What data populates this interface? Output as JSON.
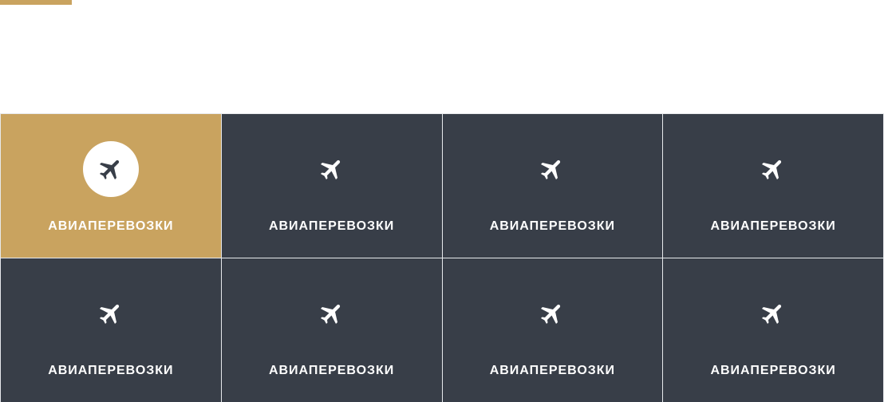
{
  "accent_color": "#c9a35f",
  "tile_color": "#383e48",
  "tiles": [
    {
      "label": "АВИАПЕРЕВОЗКИ",
      "icon": "airplane-icon",
      "active": true
    },
    {
      "label": "АВИАПЕРЕВОЗКИ",
      "icon": "airplane-icon",
      "active": false
    },
    {
      "label": "АВИАПЕРЕВОЗКИ",
      "icon": "airplane-icon",
      "active": false
    },
    {
      "label": "АВИАПЕРЕВОЗКИ",
      "icon": "airplane-icon",
      "active": false
    },
    {
      "label": "АВИАПЕРЕВОЗКИ",
      "icon": "airplane-icon",
      "active": false
    },
    {
      "label": "АВИАПЕРЕВОЗКИ",
      "icon": "airplane-icon",
      "active": false
    },
    {
      "label": "АВИАПЕРЕВОЗКИ",
      "icon": "airplane-icon",
      "active": false
    },
    {
      "label": "АВИАПЕРЕВОЗКИ",
      "icon": "airplane-icon",
      "active": false
    }
  ]
}
